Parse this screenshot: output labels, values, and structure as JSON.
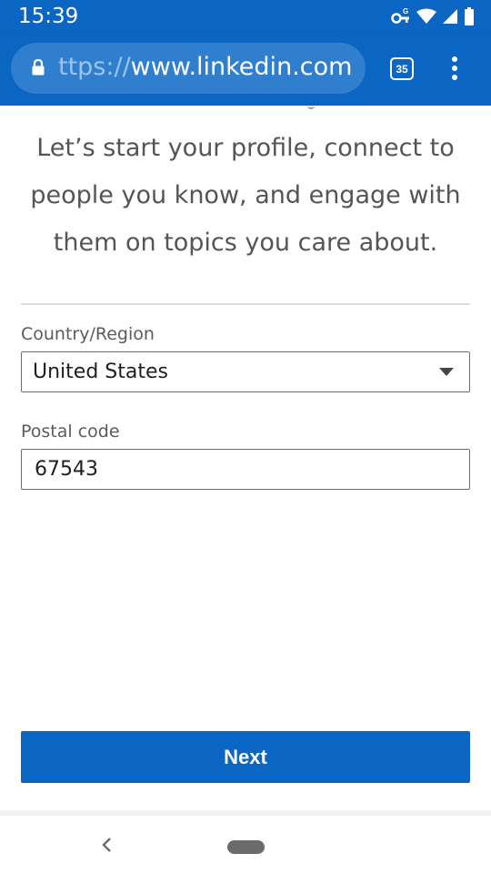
{
  "status_bar": {
    "time": "15:39",
    "icons": [
      "vpn-key-icon",
      "wifi-icon",
      "signal-icon",
      "battery-icon"
    ]
  },
  "browser": {
    "url_prefix": "ttps://",
    "url_host": "www.linkedin.com",
    "tab_count": "35"
  },
  "page": {
    "intro_text": "Let’s start your profile, connect to people you know, and engage with them on topics you care about.",
    "country": {
      "label": "Country/Region",
      "selected": "United States"
    },
    "postal": {
      "label": "Postal code",
      "value": "67543"
    },
    "next_label": "Next"
  },
  "colors": {
    "brand_blue": "#0a66c2",
    "url_pill": "#2f7fce",
    "text_gray": "#555555"
  }
}
